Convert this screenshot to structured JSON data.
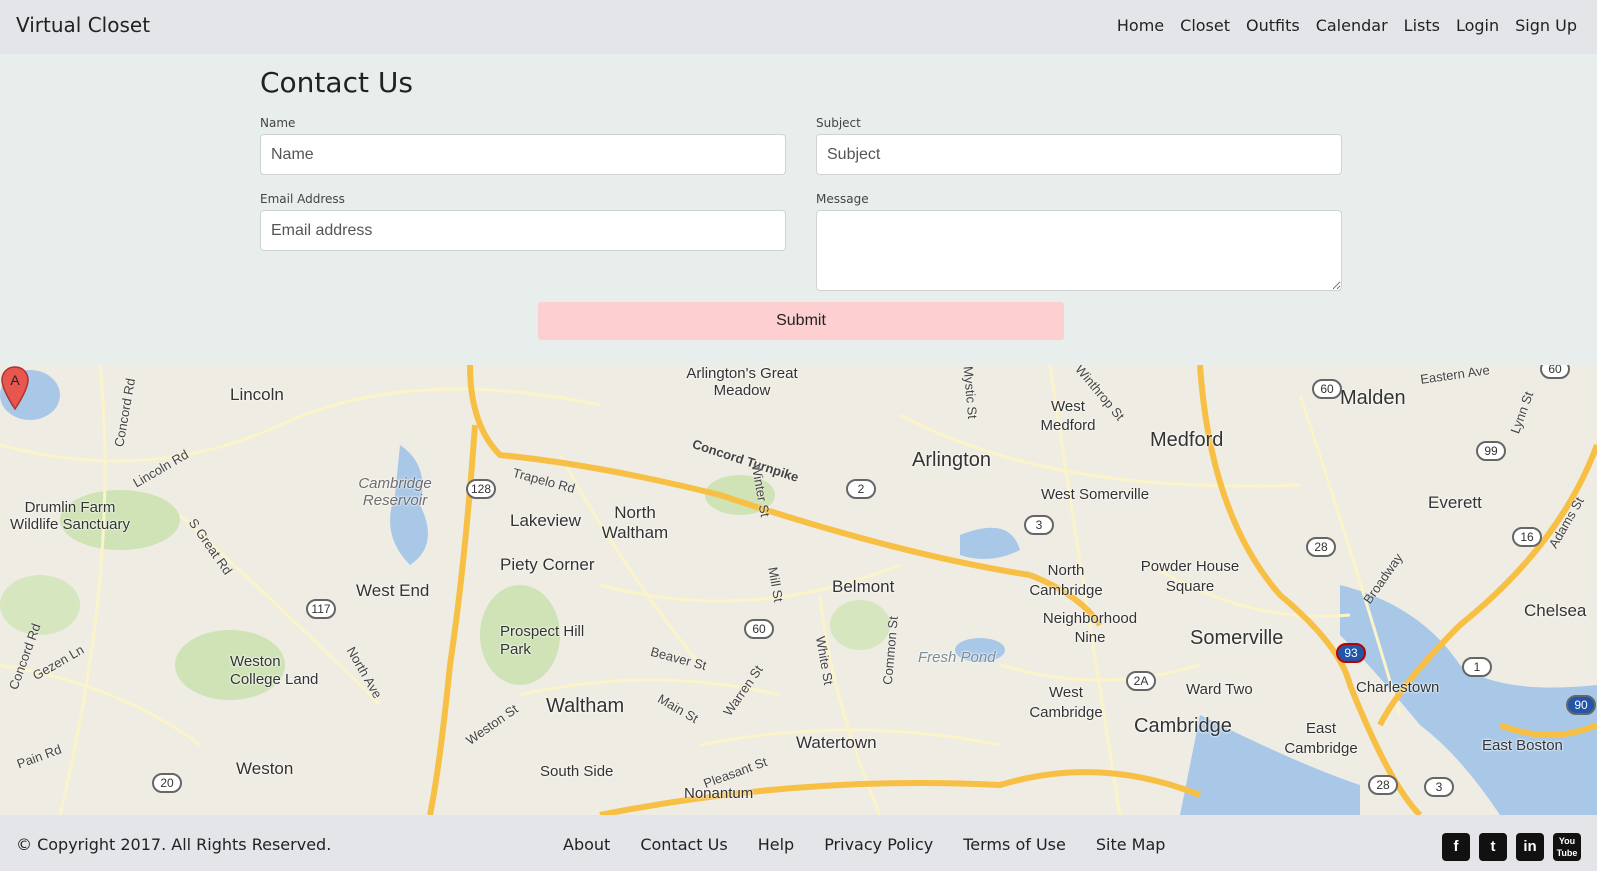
{
  "brand": "Virtual Closet",
  "nav": [
    "Home",
    "Closet",
    "Outfits",
    "Calendar",
    "Lists",
    "Login",
    "Sign Up"
  ],
  "contact": {
    "title": "Contact Us",
    "name_label": "Name",
    "name_placeholder": "Name",
    "subject_label": "Subject",
    "subject_placeholder": "Subject",
    "email_label": "Email Address",
    "email_placeholder": "Email address",
    "message_label": "Message",
    "submit_label": "Submit"
  },
  "map": {
    "marker_label": "A",
    "towns": [
      "Lincoln",
      "Arlington's Great Meadow",
      "West Medford",
      "Malden",
      "Medford",
      "Arlington",
      "Drumlin Farm Wildlife Sanctuary",
      "Cambridge Reservoir",
      "Lakeview",
      "North Waltham",
      "West Somerville",
      "Everett",
      "Piety Corner",
      "Powder House Square",
      "North Cambridge",
      "Belmont",
      "West End",
      "Neighborhood Nine",
      "Somerville",
      "Chelsea",
      "Prospect Hill Park",
      "Weston College Land",
      "Fresh Pond",
      "West Cambridge",
      "Ward Two",
      "Charlestown",
      "Waltham",
      "Cambridge",
      "East Cambridge",
      "Watertown",
      "East Boston",
      "Weston",
      "South Side",
      "Nonantum"
    ],
    "roads": [
      "Concord Rd",
      "Lincoln Rd",
      "S Great Rd",
      "Concord Turnpike",
      "Trapelo Rd",
      "Winter St",
      "Mill St",
      "Beaver St",
      "North Ave",
      "Gezen Ln",
      "Main St",
      "Warren St",
      "White St",
      "Common St",
      "Pleasant St",
      "Weston St",
      "Mystic St",
      "Winthrop St",
      "Broadway",
      "Eastern Ave",
      "Lynn St",
      "Adams St",
      "Concord Rd",
      "Pain Rd"
    ],
    "shields": [
      "128",
      "2",
      "3",
      "117",
      "60",
      "2A",
      "60",
      "99",
      "28",
      "16",
      "93",
      "1",
      "20",
      "28",
      "3",
      "90",
      "60"
    ]
  },
  "footer": {
    "copyright": "© Copyright 2017. All Rights Reserved.",
    "links": [
      "About",
      "Contact Us",
      "Help",
      "Privacy Policy",
      "Terms of Use",
      "Site Map"
    ],
    "social": [
      {
        "icon": "facebook-icon",
        "glyph": "f"
      },
      {
        "icon": "twitter-icon",
        "glyph": "t"
      },
      {
        "icon": "linkedin-icon",
        "glyph": "in"
      },
      {
        "icon": "youtube-icon",
        "glyph": "You Tube"
      }
    ]
  }
}
